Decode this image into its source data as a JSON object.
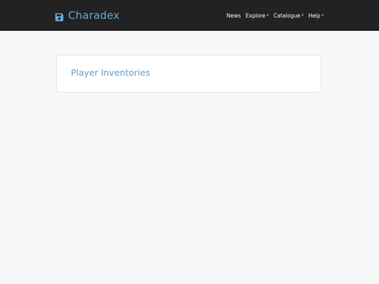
{
  "navbar": {
    "brand": {
      "name": "Charadex",
      "icon": "floppy-disk-icon"
    },
    "links": [
      {
        "label": "News",
        "dropdown": false
      },
      {
        "label": "Explore",
        "dropdown": true
      },
      {
        "label": "Catalogue",
        "dropdown": true
      },
      {
        "label": "Help",
        "dropdown": true
      }
    ]
  },
  "main": {
    "card": {
      "title": "Player Inventories"
    }
  },
  "colors": {
    "navbar_bg": "#222222",
    "brand": "#6aa9d6",
    "title": "#5b9bcb",
    "page_bg": "#f7f7f7"
  }
}
